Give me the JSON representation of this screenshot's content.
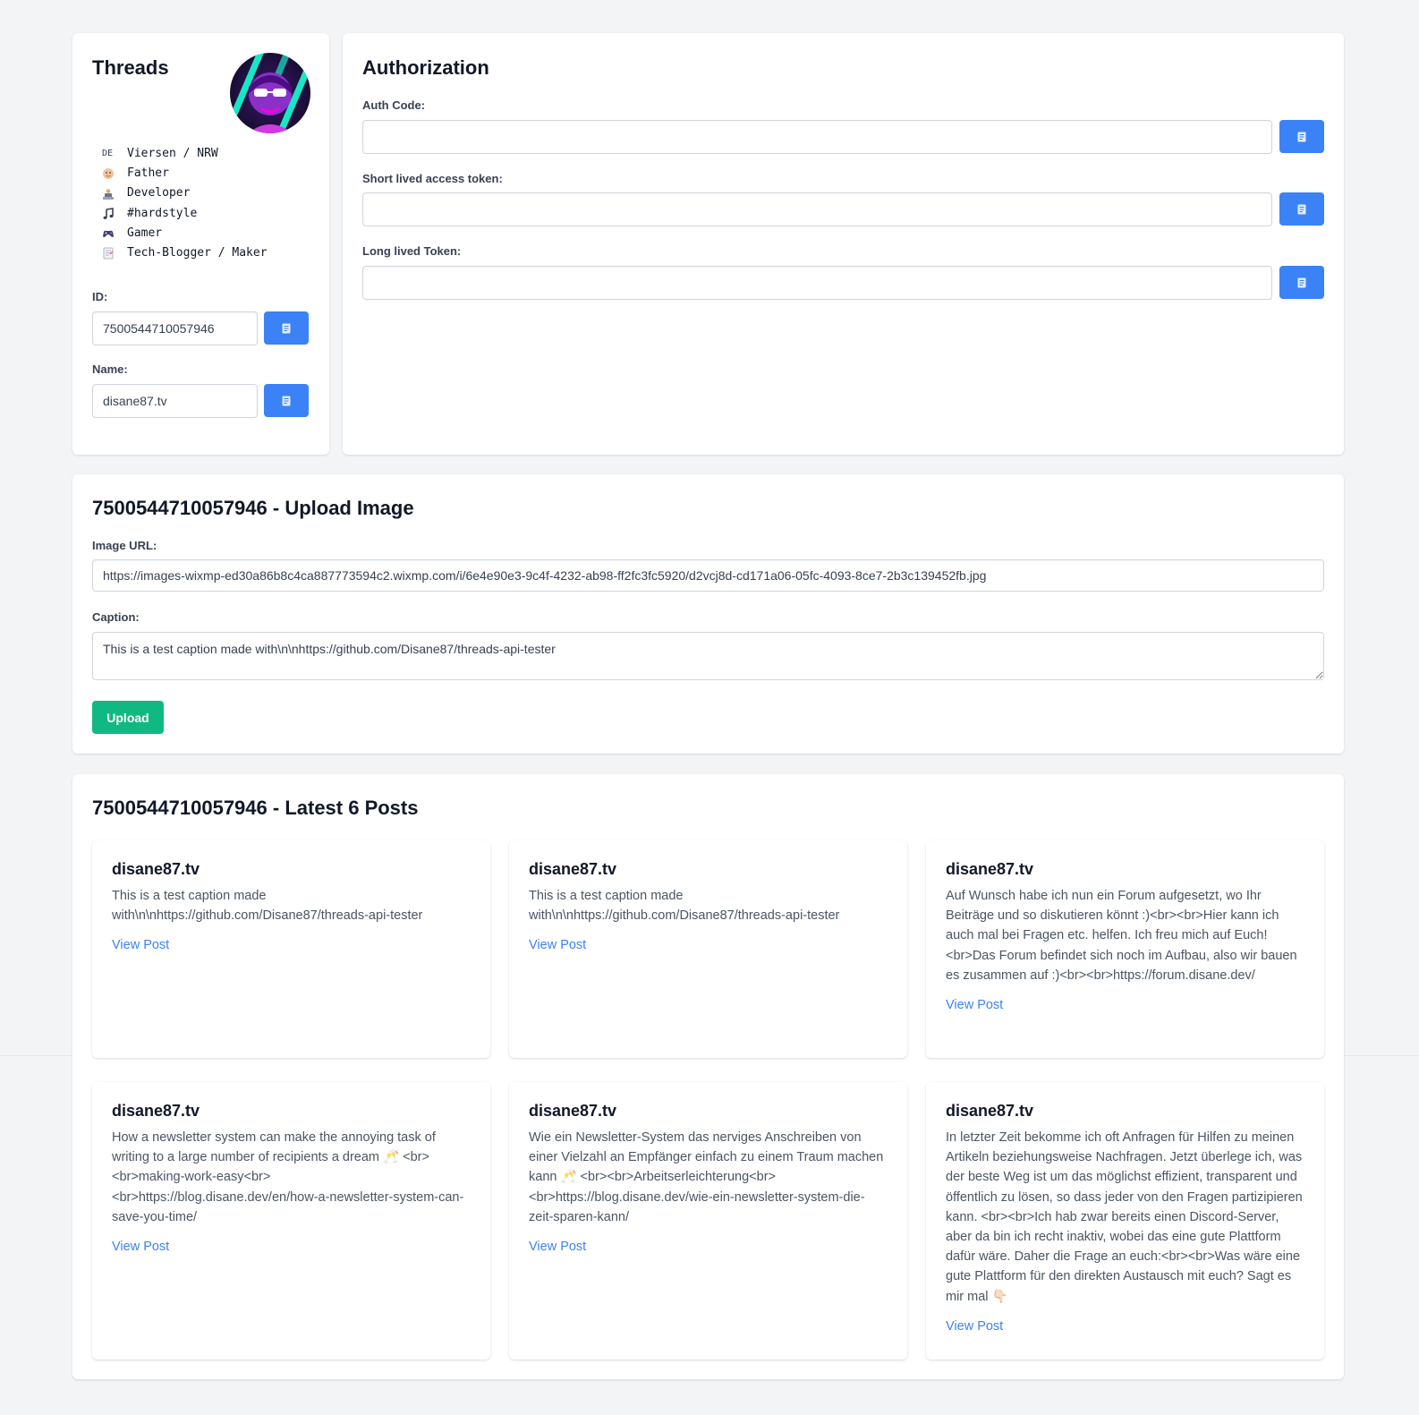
{
  "profile": {
    "title": "Threads",
    "bio": [
      {
        "icon": "de-flag-icon",
        "text": "Viersen / NRW"
      },
      {
        "icon": "baby-icon",
        "text": "Father"
      },
      {
        "icon": "developer-icon",
        "text": "Developer"
      },
      {
        "icon": "music-notes-icon",
        "text": "#hardstyle"
      },
      {
        "icon": "gamepad-icon",
        "text": "Gamer"
      },
      {
        "icon": "memo-icon",
        "text": "Tech-Blogger / Maker"
      }
    ],
    "flag_text": "DE",
    "id_label": "ID:",
    "id_value": "7500544710057946",
    "name_label": "Name:",
    "name_value": "disane87.tv"
  },
  "auth": {
    "title": "Authorization",
    "fields": [
      {
        "label": "Auth Code:",
        "value": ""
      },
      {
        "label": "Short lived access token:",
        "value": ""
      },
      {
        "label": "Long lived Token:",
        "value": ""
      }
    ]
  },
  "upload": {
    "title": "7500544710057946 - Upload Image",
    "image_url_label": "Image URL:",
    "image_url_value": "https://images-wixmp-ed30a86b8c4ca887773594c2.wixmp.com/i/6e4e90e3-9c4f-4232-ab98-ff2fc3fc5920/d2vcj8d-cd171a06-05fc-4093-8ce7-2b3c139452fb.jpg",
    "caption_label": "Caption:",
    "caption_value": "This is a test caption made with\\n\\nhttps://github.com/Disane87/threads-api-tester",
    "upload_button": "Upload"
  },
  "posts": {
    "title": "7500544710057946 - Latest 6 Posts",
    "link_label": "View Post",
    "items": [
      {
        "author": "disane87.tv",
        "text": "This is a test caption made with\\n\\nhttps://github.com/Disane87/threads-api-tester"
      },
      {
        "author": "disane87.tv",
        "text": "This is a test caption made with\\n\\nhttps://github.com/Disane87/threads-api-tester"
      },
      {
        "author": "disane87.tv",
        "text": "Auf Wunsch habe ich nun ein Forum aufgesetzt, wo Ihr Beiträge und so diskutieren könnt :)<br><br>Hier kann ich auch mal bei Fragen etc. helfen. Ich freu mich auf Euch!<br>Das Forum befindet sich noch im Aufbau, also wir bauen es zusammen auf :)<br><br>https://forum.disane.dev/"
      },
      {
        "author": "disane87.tv",
        "text": "How a newsletter system can make the annoying task of writing to a large number of recipients a dream 🥂 <br><br>making-work-easy<br><br>https://blog.disane.dev/en/how-a-newsletter-system-can-save-you-time/"
      },
      {
        "author": "disane87.tv",
        "text": "Wie ein Newsletter-System das nerviges Anschreiben von einer Vielzahl an Empfänger einfach zu einem Traum machen kann 🥂 <br><br>Arbeitserleichterung<br><br>https://blog.disane.dev/wie-ein-newsletter-system-die-zeit-sparen-kann/"
      },
      {
        "author": "disane87.tv",
        "text": "In letzter Zeit bekomme ich oft Anfragen für Hilfen zu meinen Artikeln beziehungsweise Nachfragen. Jetzt überlege ich, was der beste Weg ist um das möglichst effizient, transparent und öffentlich zu lösen, so dass jeder von den Fragen partizipieren kann. <br><br>Ich hab zwar bereits einen Discord-Server, aber da bin ich recht inaktiv, wobei das eine gute Plattform dafür wäre. Daher die Frage an euch:<br><br>Was wäre eine gute Plattform für den direkten Austausch mit euch? Sagt es mir mal 👇🏻"
      }
    ]
  },
  "colors": {
    "primary": "#3b82f6",
    "success": "#10b981",
    "background": "#f3f4f6"
  }
}
